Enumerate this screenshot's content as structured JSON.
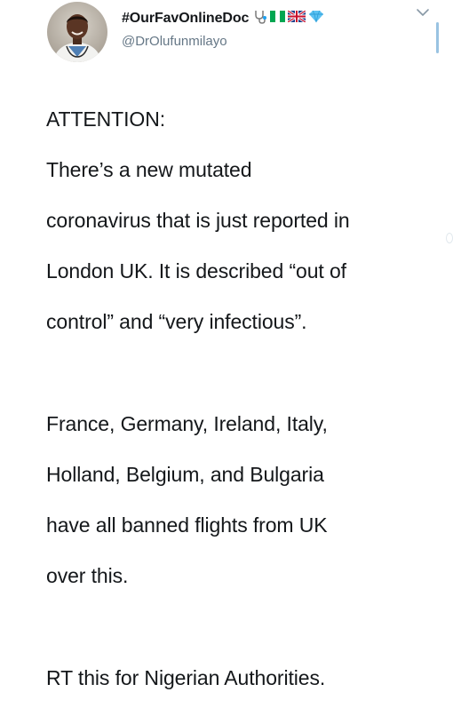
{
  "tweet": {
    "display_name": "#OurFavOnlineDoc",
    "name_badges": [
      "stethoscope-icon",
      "nigeria-flag-icon",
      "uk-flag-icon",
      "gem-icon"
    ],
    "handle": "@DrOlufunmilayo",
    "body": {
      "p1_l1": "ATTENTION:",
      "p1_l2": "There’s a new mutated",
      "p1_l3": "coronavirus that is just reported in",
      "p1_l4": "London UK. It is described “out of",
      "p1_l5": "control” and “very infectious”.",
      "p2_l1": "France, Germany, Ireland, Italy,",
      "p2_l2": "Holland, Belgium, and Bulgaria",
      "p2_l3": "have all banned flights from UK",
      "p2_l4": "over this.",
      "p3_l1": "RT this for Nigerian Authorities."
    }
  },
  "colors": {
    "text": "#14171a",
    "secondary_text": "#657786",
    "accent": "#1da1f2"
  }
}
